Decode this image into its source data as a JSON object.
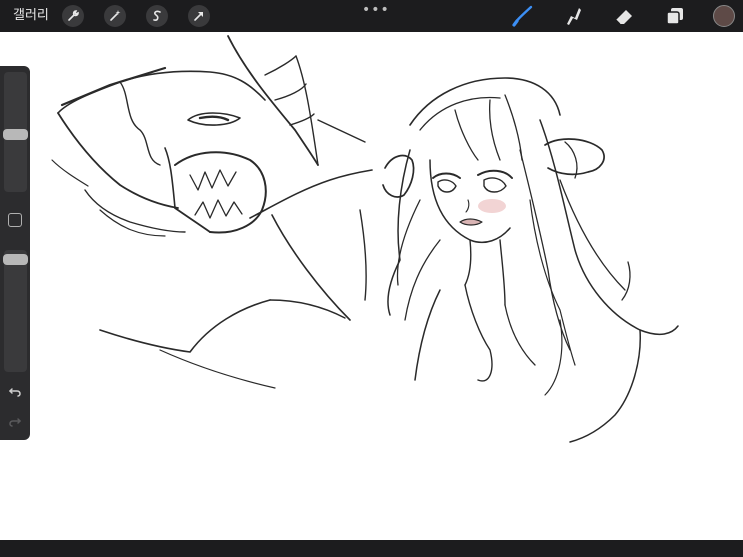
{
  "topbar": {
    "gallery_label": "갤러리",
    "left_tools": [
      "wrench-icon",
      "magic-wand-icon",
      "selection-icon",
      "transform-arrow-icon"
    ],
    "more_label": "•••",
    "right_tools": [
      "brush-icon",
      "smudge-icon",
      "eraser-icon",
      "layers-icon"
    ],
    "active_tool_color": "#3c8ff5",
    "current_color": "#5e4a47"
  },
  "sidebar": {
    "brush_size_level": 0.52,
    "opacity_level": 0.04
  },
  "canvas": {
    "background": "#ffffff",
    "stroke_color": "#2a2a2a"
  }
}
